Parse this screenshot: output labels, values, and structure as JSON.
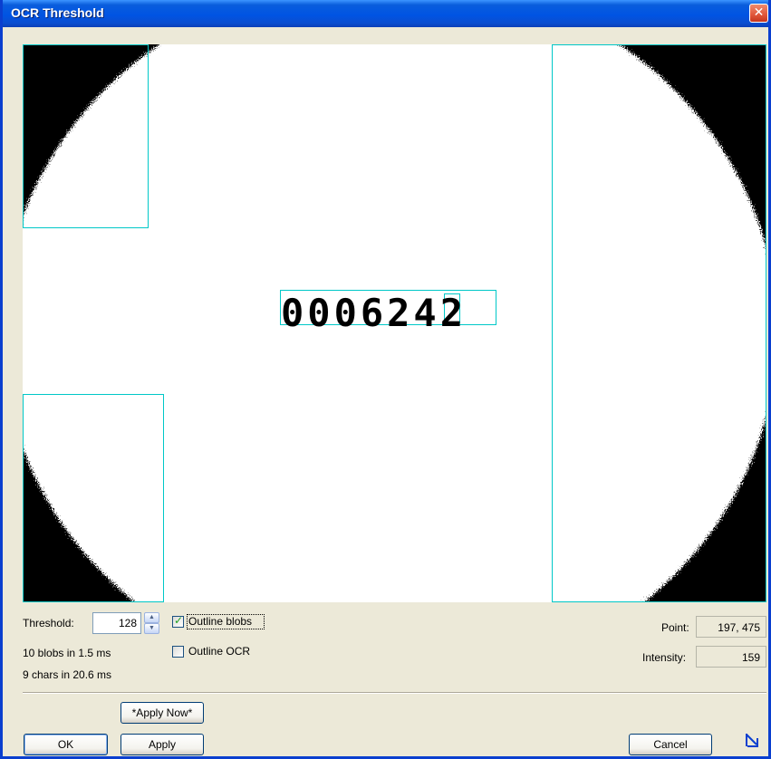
{
  "window": {
    "title": "OCR Threshold",
    "close_glyph": "✕"
  },
  "image": {
    "ocr_text": "0006242"
  },
  "controls": {
    "threshold_label": "Threshold:",
    "threshold_value": "128",
    "blobs_stat": "10 blobs in 1.5 ms",
    "chars_stat": "9 chars in 20.6 ms",
    "outline_blobs_label": "Outline blobs",
    "outline_blobs_checked": true,
    "outline_ocr_label": "Outline OCR",
    "outline_ocr_checked": false,
    "point_label": "Point:",
    "point_value": "197, 475",
    "intensity_label": "Intensity:",
    "intensity_value": "159"
  },
  "buttons": {
    "apply_now": "*Apply Now*",
    "ok": "OK",
    "apply": "Apply",
    "cancel": "Cancel"
  },
  "icons": {
    "close": "close-icon",
    "spin_up": "chevron-up-icon",
    "spin_down": "chevron-down-icon",
    "corner": "resize-arrow-icon"
  },
  "colors": {
    "title_bar": "#0054e3",
    "close_button": "#e0573a",
    "outline": "#00c8c8",
    "dialog_bg": "#ece9d8"
  }
}
